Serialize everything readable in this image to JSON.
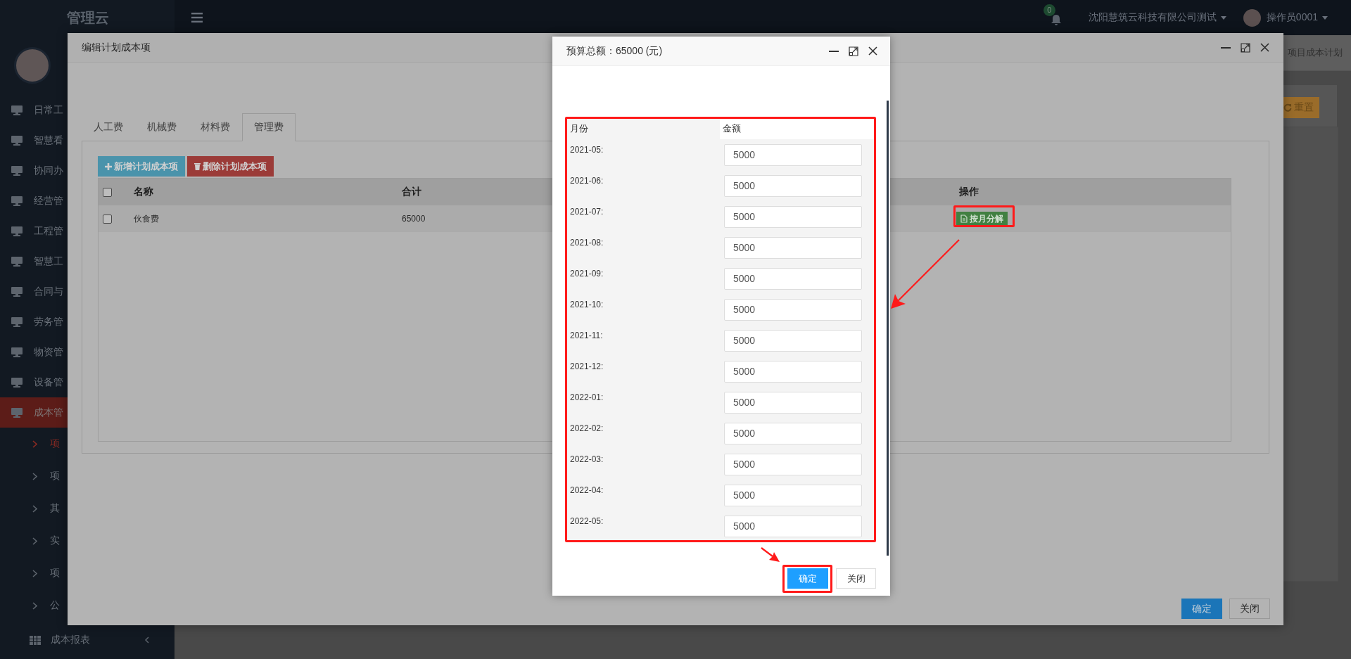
{
  "top_bar": {
    "logo": "管理云",
    "notification_count": "0",
    "company": "沈阳慧筑云科技有限公司测试",
    "user": "操作员0001"
  },
  "sidebar": {
    "items": [
      {
        "label": "日常工",
        "selected": false
      },
      {
        "label": "智慧看",
        "selected": false
      },
      {
        "label": "协同办",
        "selected": false
      },
      {
        "label": "经营管",
        "selected": false
      },
      {
        "label": "工程管",
        "selected": false
      },
      {
        "label": "智慧工",
        "selected": false
      },
      {
        "label": "合同与",
        "selected": false
      },
      {
        "label": "劳务管",
        "selected": false
      },
      {
        "label": "物资管",
        "selected": false
      },
      {
        "label": "设备管",
        "selected": false
      },
      {
        "label": "成本管",
        "selected": true,
        "children": [
          {
            "kind": "link",
            "label": "项",
            "selected": true
          },
          {
            "kind": "link",
            "label": "项",
            "selected": false
          },
          {
            "kind": "link",
            "label": "其",
            "selected": false
          },
          {
            "kind": "link",
            "label": "实",
            "selected": false
          },
          {
            "kind": "link",
            "label": "项",
            "selected": false
          },
          {
            "kind": "link",
            "label": "公",
            "selected": false
          },
          {
            "kind": "group",
            "label": "成本报表",
            "selected": false
          }
        ]
      }
    ]
  },
  "background": {
    "tab": "项目成本计划",
    "reset_button": "重置"
  },
  "edit_dialog": {
    "title": "编辑计划成本项",
    "tabs": [
      {
        "label": "人工费",
        "selected": false
      },
      {
        "label": "机械费",
        "selected": false
      },
      {
        "label": "材料费",
        "selected": false
      },
      {
        "label": "管理费",
        "selected": true
      }
    ],
    "add_button": "新增计划成本项",
    "delete_button": "删除计划成本项",
    "table": {
      "select_all_checked": false,
      "columns": [
        "名称",
        "合计",
        "操作"
      ],
      "rows": [
        {
          "checked": false,
          "name": "伙食费",
          "total": "65000",
          "action": "按月分解"
        }
      ]
    },
    "footer_buttons": [
      "确定",
      "关闭"
    ]
  },
  "budget_dialog": {
    "title": "预算总额：65000 (元)",
    "columns": [
      "月份",
      "金额"
    ],
    "rows": [
      {
        "month": "2021-05:",
        "amount": "5000"
      },
      {
        "month": "2021-06:",
        "amount": "5000"
      },
      {
        "month": "2021-07:",
        "amount": "5000"
      },
      {
        "month": "2021-08:",
        "amount": "5000"
      },
      {
        "month": "2021-09:",
        "amount": "5000"
      },
      {
        "month": "2021-10:",
        "amount": "5000"
      },
      {
        "month": "2021-11:",
        "amount": "5000"
      },
      {
        "month": "2021-12:",
        "amount": "5000"
      },
      {
        "month": "2022-01:",
        "amount": "5000"
      },
      {
        "month": "2022-02:",
        "amount": "5000"
      },
      {
        "month": "2022-03:",
        "amount": "5000"
      },
      {
        "month": "2022-04:",
        "amount": "5000"
      },
      {
        "month": "2022-05:",
        "amount": "5000"
      }
    ],
    "footer_buttons": [
      "确定",
      "关闭"
    ]
  }
}
